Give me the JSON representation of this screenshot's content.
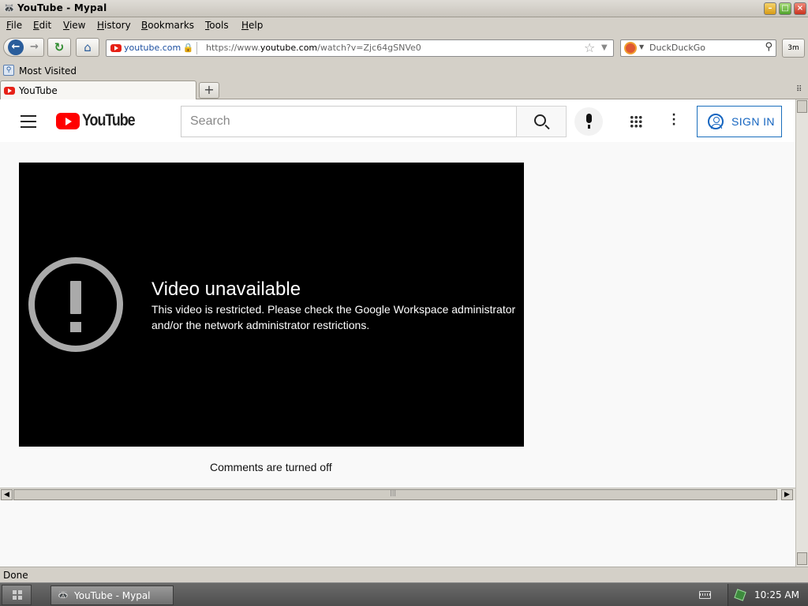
{
  "window": {
    "title": "YouTube - Mypal",
    "app_icon": "raccoon-icon"
  },
  "menu": [
    "File",
    "Edit",
    "View",
    "History",
    "Bookmarks",
    "Tools",
    "Help"
  ],
  "navigation": {
    "site_identity": "youtube.com",
    "url_prefix": "https://www.",
    "url_domain": "youtube.com",
    "url_path": "/watch?v=Zjc64gSNVe0",
    "search_engine": "DuckDuckGo",
    "addon_label": "3m"
  },
  "bookmarks_toolbar": {
    "items": [
      "Most Visited"
    ]
  },
  "tabs": [
    {
      "label": "YouTube",
      "active": true
    }
  ],
  "youtube": {
    "logo_text": "YouTube",
    "search_placeholder": "Search",
    "sign_in_label": "SIGN IN",
    "error_title": "Video unavailable",
    "error_message": "This video is restricted. Please check the Google Workspace administrator and/or the network administrator restrictions.",
    "comments_status": "Comments are turned off"
  },
  "status_bar": {
    "text": "Done"
  },
  "taskbar": {
    "task_label": "YouTube - Mypal",
    "clock": "10:25 AM"
  },
  "colors": {
    "youtube_red": "#ff0000",
    "sign_in_blue": "#1565c0",
    "player_background": "#000000"
  }
}
